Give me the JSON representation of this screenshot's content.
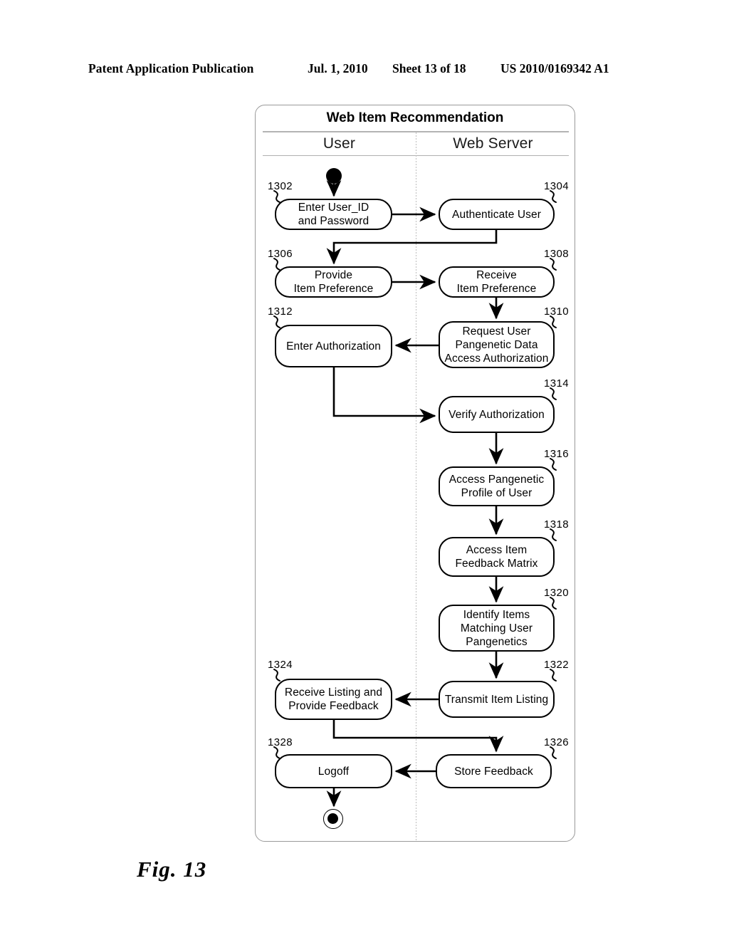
{
  "header": {
    "publication": "Patent Application Publication",
    "date": "Jul. 1, 2010",
    "sheet": "Sheet 13 of 18",
    "number": "US 2010/0169342 A1"
  },
  "figure": {
    "caption": "Fig.  13"
  },
  "diagram": {
    "title": "Web Item Recommendation",
    "lanes": [
      {
        "id": "user",
        "label": "User"
      },
      {
        "id": "server",
        "label": "Web Server"
      }
    ],
    "start_node": "start-node",
    "end_node": "end-node",
    "nodes": [
      {
        "ref": "1302",
        "lane": "user",
        "label": "Enter User_ID\nand Password"
      },
      {
        "ref": "1304",
        "lane": "server",
        "label": "Authenticate User"
      },
      {
        "ref": "1306",
        "lane": "user",
        "label": "Provide\nItem Preference"
      },
      {
        "ref": "1308",
        "lane": "server",
        "label": "Receive\nItem Preference"
      },
      {
        "ref": "1312",
        "lane": "user",
        "label": "Enter Authorization"
      },
      {
        "ref": "1310",
        "lane": "server",
        "label": "Request User\nPangenetic Data\nAccess Authorization"
      },
      {
        "ref": "1314",
        "lane": "server",
        "label": "Verify Authorization"
      },
      {
        "ref": "1316",
        "lane": "server",
        "label": "Access Pangenetic\nProfile of User"
      },
      {
        "ref": "1318",
        "lane": "server",
        "label": "Access Item\nFeedback Matrix"
      },
      {
        "ref": "1320",
        "lane": "server",
        "label": "Identify Items\nMatching User\nPangenetics"
      },
      {
        "ref": "1324",
        "lane": "user",
        "label": "Receive Listing and\nProvide Feedback"
      },
      {
        "ref": "1322",
        "lane": "server",
        "label": "Transmit Item Listing"
      },
      {
        "ref": "1328",
        "lane": "user",
        "label": "Logoff"
      },
      {
        "ref": "1326",
        "lane": "server",
        "label": "Store Feedback"
      }
    ],
    "colors": {
      "node_border": "#000000",
      "container_border": "#9a9a9a",
      "lane_divider": "#bdbdbd",
      "connector": "#000000"
    }
  }
}
